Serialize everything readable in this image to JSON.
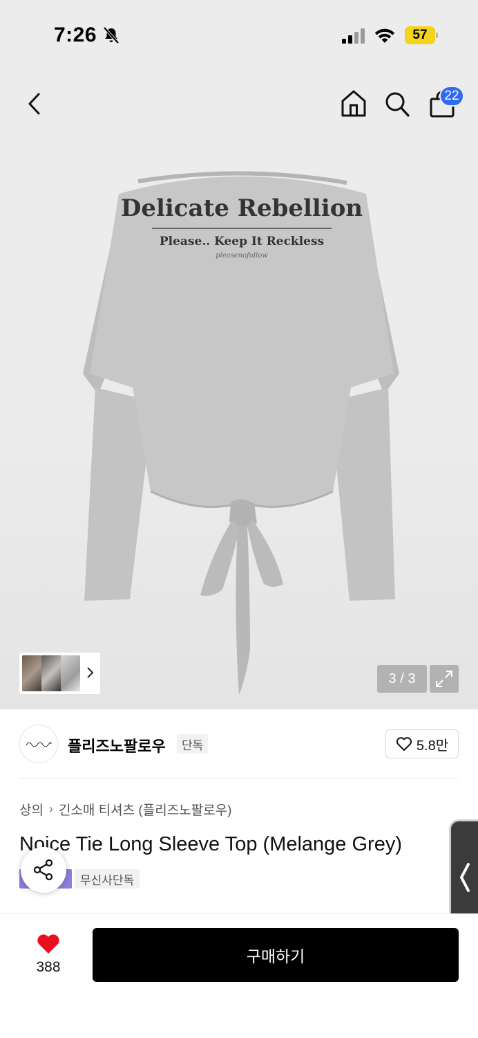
{
  "status_bar": {
    "time": "7:26",
    "battery": "57"
  },
  "header": {
    "cart_count": "22"
  },
  "gallery": {
    "counter": "3 / 3"
  },
  "brand": {
    "name": "플리즈노팔로우",
    "tag": "단독",
    "likes": "5.8만"
  },
  "breadcrumb": {
    "category": "상의",
    "subcategory": "긴소매 티셔츠 (플리즈노팔로우)"
  },
  "product": {
    "title": "Noice Tie Long Sleeve Top (Melange Grey)",
    "badge": "무신사단독"
  },
  "print": {
    "line1": "Delicate Rebellion",
    "line2": "Please.. Keep It Reckless",
    "line3": "pleasenofollow"
  },
  "bottom_bar": {
    "heart_count": "388",
    "buy_label": "구매하기"
  },
  "colors": {
    "accent_blue": "#2f6bf2",
    "heart_red": "#e8101f",
    "buy_black": "#000000",
    "badge_purple": "#8b7fd8",
    "battery_yellow": "#f5d21b"
  }
}
